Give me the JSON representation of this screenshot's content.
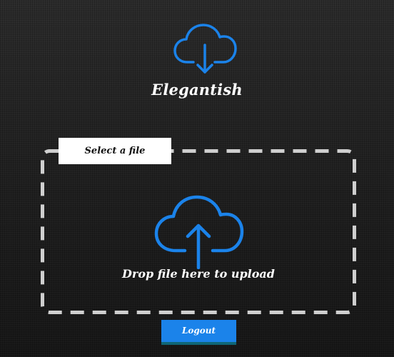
{
  "header": {
    "logo_icon": "cloud-download-icon",
    "title": "Elegantish"
  },
  "upload": {
    "select_file_label": "Select a file",
    "dropzone_icon": "cloud-upload-icon",
    "drop_label": "Drop file here to upload"
  },
  "actions": {
    "logout_label": "Logout"
  },
  "colors": {
    "accent": "#1b83ea",
    "button_underline": "#0f6677",
    "dropzone_border": "#cfcfcf",
    "background": "#1c1c1c"
  }
}
